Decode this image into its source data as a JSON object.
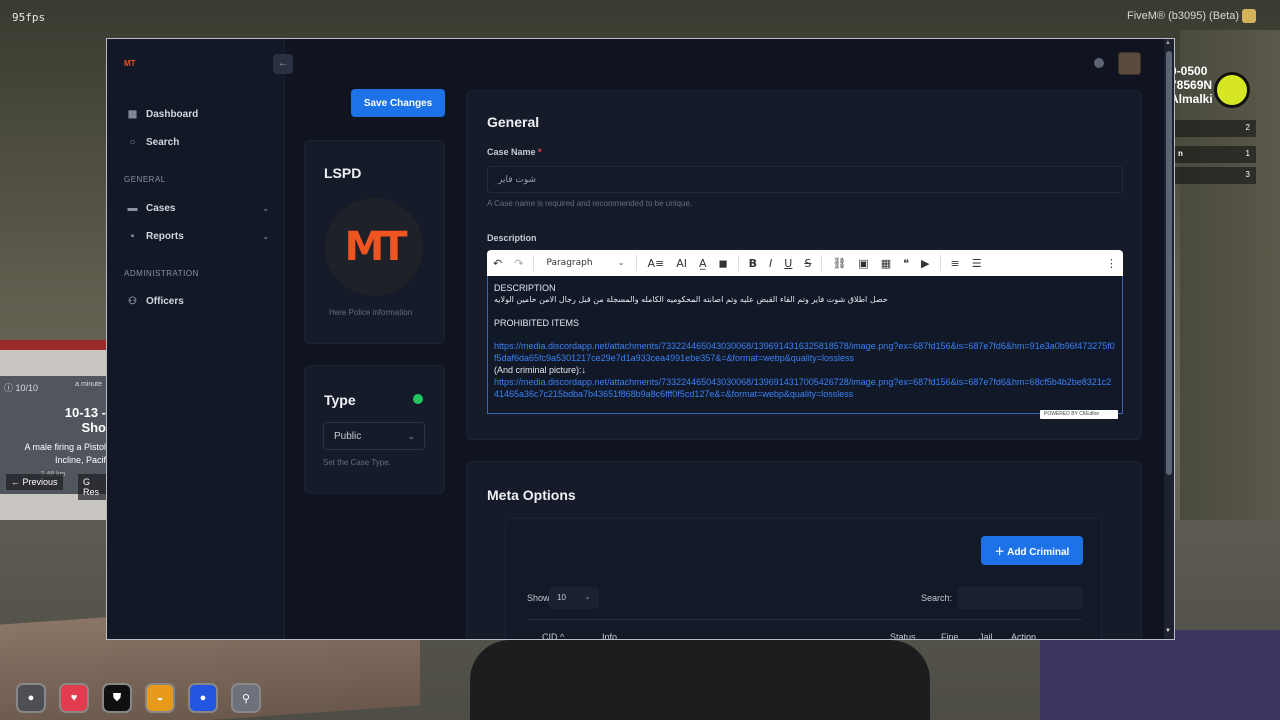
{
  "overlay": {
    "fps": "95fps",
    "fivem_label": "FiveM® (b3095) (Beta)",
    "hud_lines": [
      "0-0500",
      "78569N",
      "Almalki"
    ],
    "hud_rows": [
      {
        "label": "",
        "value": "2"
      },
      {
        "label": "n",
        "value": "1"
      },
      {
        "label": "",
        "value": "3"
      }
    ],
    "notification": {
      "count": "10/10",
      "time": "a minute",
      "title": "10-13 - Sho",
      "body_line1": "A male firing a Pistol",
      "body_line2": "Incline, Pacif",
      "distance": "2.48 km",
      "prev_key": "←",
      "prev_label": "Previous",
      "next_key": "G",
      "next_label": "Res"
    }
  },
  "sidebar": {
    "logo": "MT",
    "collapse_icon": "←",
    "items": [
      {
        "label": "Dashboard",
        "icon": "grid-icon"
      },
      {
        "label": "Search",
        "icon": "search-icon"
      }
    ],
    "section_general": "GENERAL",
    "general_items": [
      {
        "label": "Cases",
        "icon": "folder-icon"
      },
      {
        "label": "Reports",
        "icon": "report-icon"
      }
    ],
    "section_admin": "ADMINISTRATION",
    "admin_items": [
      {
        "label": "Officers",
        "icon": "users-icon"
      }
    ]
  },
  "toolbar": {
    "save_label": "Save Changes"
  },
  "department_card": {
    "title": "LSPD",
    "logo_text": "MT",
    "caption": "Here Police information"
  },
  "type_card": {
    "title": "Type",
    "status_color": "#22c55e",
    "selected": "Public",
    "hint": "Set the Case Type."
  },
  "general": {
    "title": "General",
    "case_name_label": "Case Name",
    "required_mark": "*",
    "case_name_value": "شوت فاير",
    "case_name_hint": "A Case name is required and recommended to be unique.",
    "description_label": "Description",
    "editor_toolbar": {
      "paragraph": "Paragraph"
    },
    "editor": {
      "heading1": "DESCRIPTION",
      "arabic_text": "حصل اطلاق شوت فاير وتم القاء القبض عليه وتم اصابته المحكوميه الكامله والمسجلة من قبل رجال الامن حامين الولايه",
      "heading2": "PROHIBITED ITEMS",
      "link1": "https://media.discordapp.net/attachments/733224465043030068/1396914316325818578/image.png?ex=687fd156&is=687e7fd6&hm=91e3a0b96f473275f0f5daf6da65fc9a5301217ce29e7d1a933cea4991ebe357&=&format=webp&quality=lossless",
      "criminal_picture": "(And criminal picture):↓",
      "link2": "https://media.discordapp.net/attachments/733224465043030068/1396914317005426728/image.png?ex=687fd156&is=687e7fd6&hm=68cf5b4b2be8321c241465a36c7c215bdba7b43651f868b9a8c6fff0f5cd127e&=&format=webp&quality=lossless"
    },
    "ck_badge": "POWERED BY CKEditor"
  },
  "meta": {
    "title": "Meta Options",
    "add_button": "Add Criminal",
    "show_label": "Show",
    "show_value": "10",
    "search_label": "Search:",
    "columns": [
      "CID",
      "Info",
      "Status",
      "Fine",
      "Jail",
      "Action"
    ]
  }
}
